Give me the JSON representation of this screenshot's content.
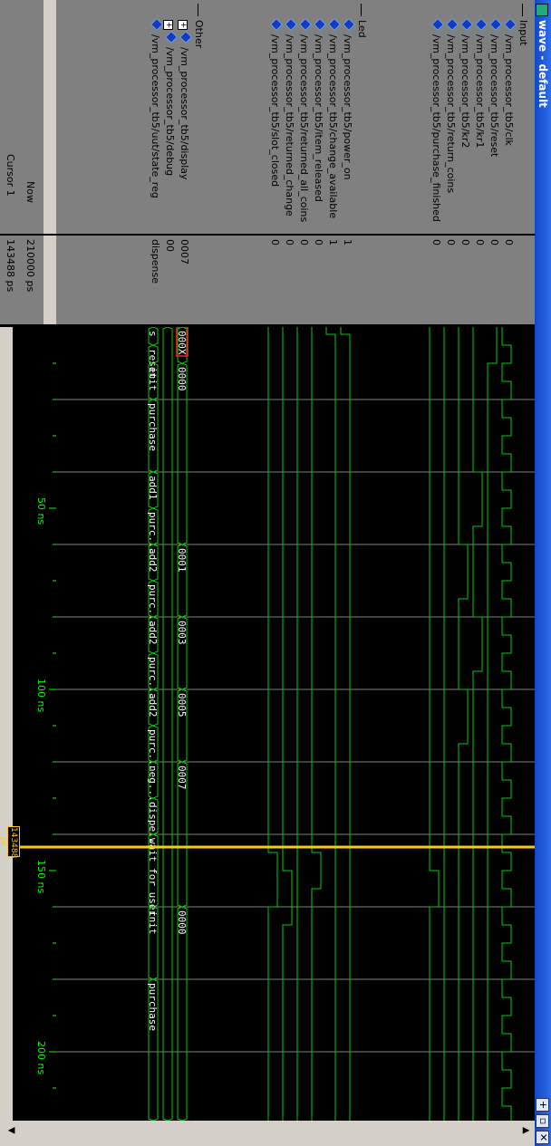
{
  "window": {
    "title": "wave - default"
  },
  "groups": {
    "input": "Input",
    "led": "Led",
    "other": "Other"
  },
  "signals": {
    "input": [
      {
        "name": "/vm_processor_tb5/clk",
        "value": "0"
      },
      {
        "name": "/vm_processor_tb5/reset",
        "value": "0"
      },
      {
        "name": "/vm_processor_tb5/kr1",
        "value": "0"
      },
      {
        "name": "/vm_processor_tb5/kr2",
        "value": "0"
      },
      {
        "name": "/vm_processor_tb5/return_coins",
        "value": "0"
      },
      {
        "name": "/vm_processor_tb5/purchase_finished",
        "value": "0"
      }
    ],
    "led": [
      {
        "name": "/vm_processor_tb5/power_on",
        "value": "1"
      },
      {
        "name": "/vm_processor_tb5/change_available",
        "value": "1"
      },
      {
        "name": "/vm_processor_tb5/item_released",
        "value": "0"
      },
      {
        "name": "/vm_processor_tb5/returned_all_coins",
        "value": "0"
      },
      {
        "name": "/vm_processor_tb5/returned_change",
        "value": "0"
      },
      {
        "name": "/vm_processor_tb5/slot_closed",
        "value": "0"
      }
    ],
    "other": [
      {
        "name": "/vm_processor_tb5/display",
        "value": "0007"
      },
      {
        "name": "/vm_processor_tb5/debug",
        "value": "00"
      },
      {
        "name": "/vm_processor_tb5/uut/state_reg",
        "value": "dispense"
      }
    ]
  },
  "status": {
    "now_label": "Now",
    "now_value": "210000 ps",
    "cursor_label": "Cursor 1",
    "cursor_value": "143488 ps"
  },
  "timeaxis": {
    "ticks": [
      "50 ns",
      "100 ns",
      "150 ns",
      "200 ns"
    ],
    "cursor_readout": "143488 ps"
  },
  "waves": {
    "display_labels": [
      "000X",
      "0000",
      "0001",
      "0003",
      "0005",
      "0007",
      "0000"
    ],
    "state_labels": [
      "s",
      "reset",
      "init",
      "purchase",
      "add1",
      "purc...",
      "add2",
      "purc...",
      "add2",
      "purc...",
      "add2",
      "purc...",
      "neg...",
      "dispe...",
      "wait for user",
      "init",
      "purchase"
    ]
  },
  "colors": {
    "wave": "#00d000",
    "cursor": "#ffcc00",
    "selected": "#ff2020",
    "grid": "#808080"
  }
}
